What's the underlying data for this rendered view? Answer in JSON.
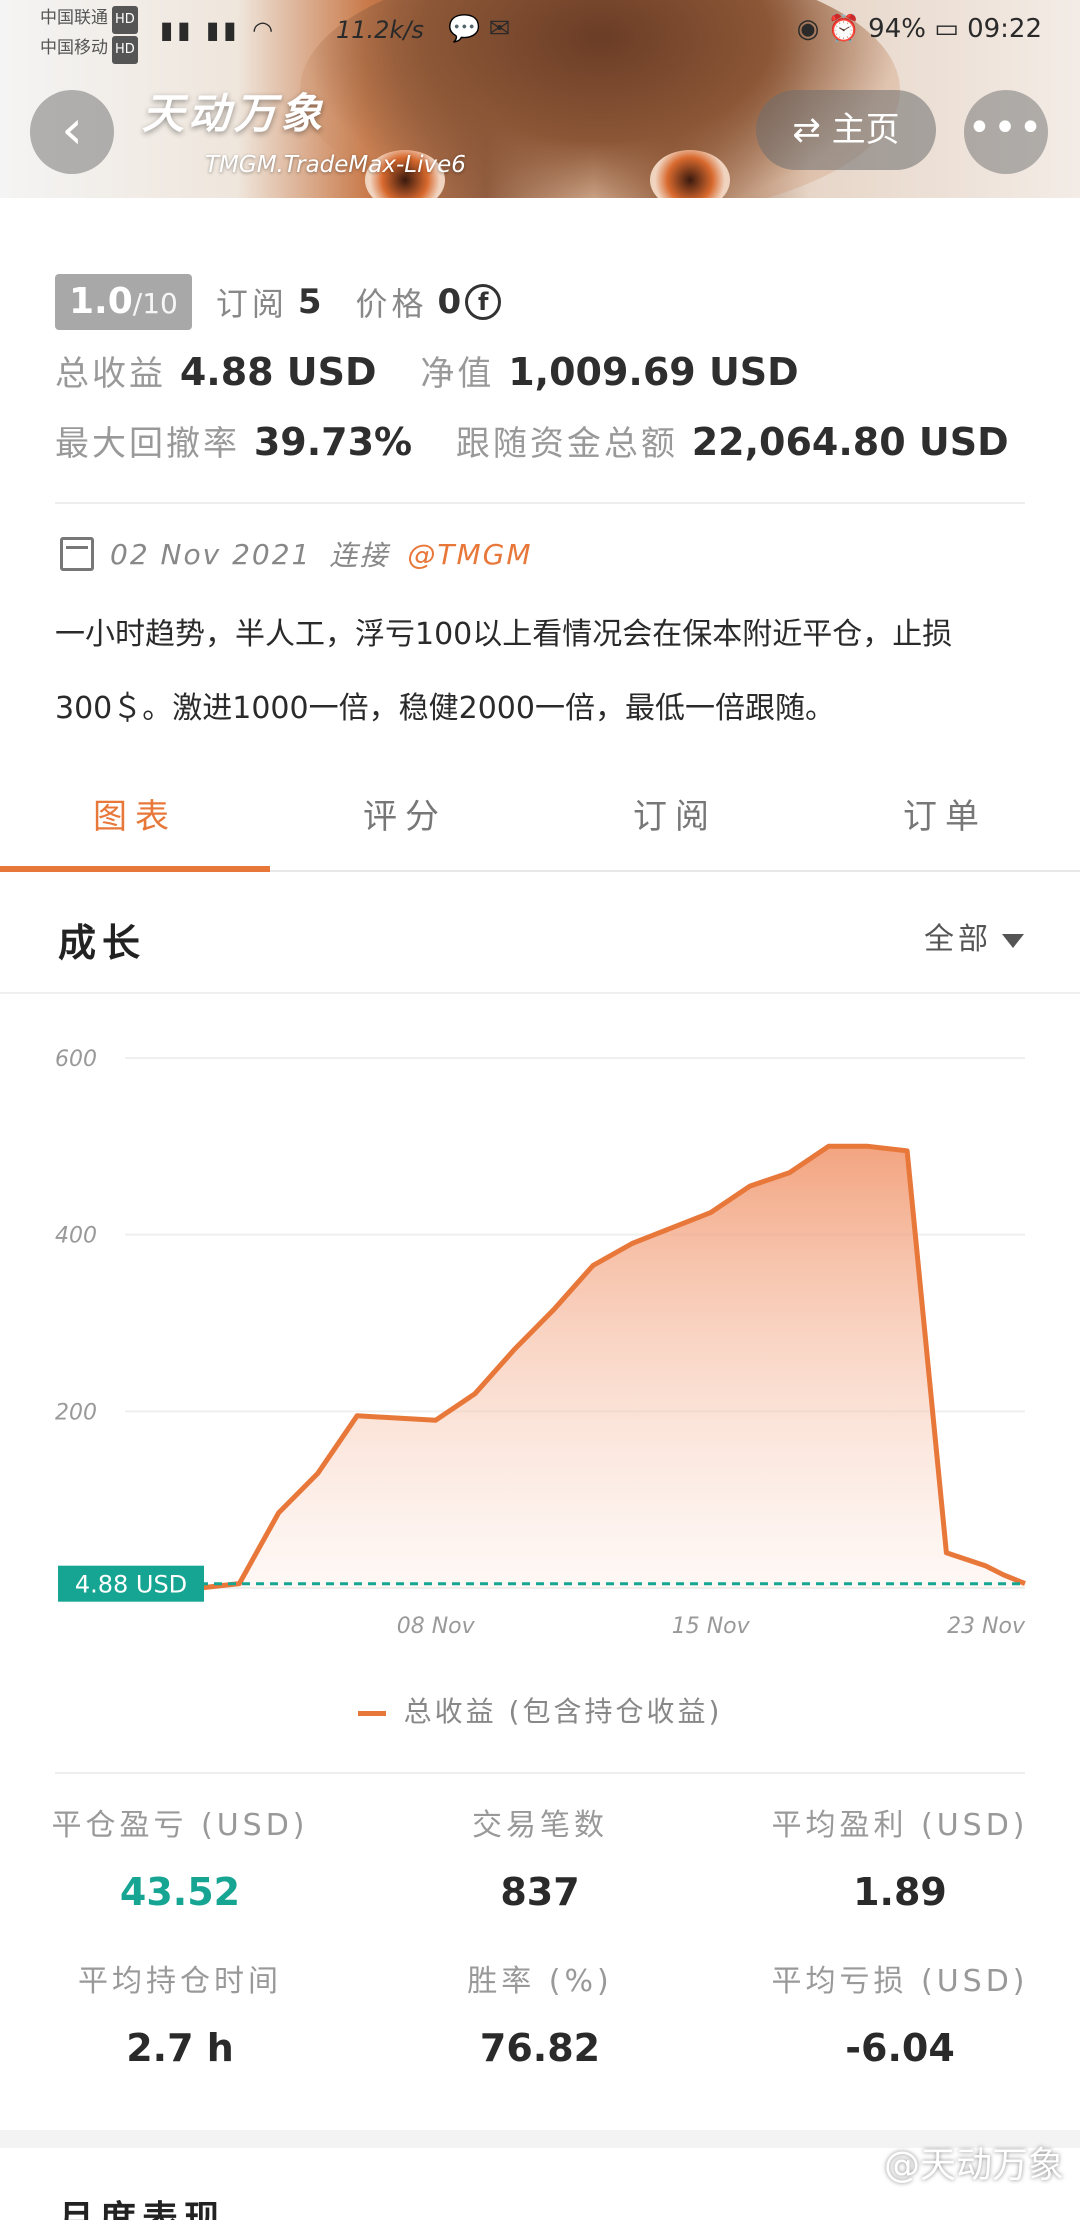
{
  "status_bar": {
    "carrier1": "中国联通",
    "carrier2": "中国移动",
    "hd": "HD",
    "speed": "11.2k/s",
    "battery": "94%",
    "time": "09:22"
  },
  "header": {
    "title": "天动万象",
    "subtitle": "TMGM.TradeMax-Live6",
    "home_label": "主页"
  },
  "profile": {
    "rating_value": "1.0",
    "rating_denominator": "/10",
    "subscribe_label": "订阅",
    "subscribe_count": "5",
    "price_label": "价格",
    "price_value": "0",
    "total_profit_label": "总收益",
    "total_profit_value": "4.88 USD",
    "equity_label": "净值",
    "equity_value": "1,009.69 USD",
    "max_drawdown_label": "最大回撤率",
    "max_drawdown_value": "39.73%",
    "follow_funds_label": "跟随资金总额",
    "follow_funds_value": "22,064.80 USD",
    "date": "02 Nov 2021",
    "connect_label": "连接",
    "connect_broker": "@TMGM",
    "description": "一小时趋势，半人工，浮亏100以上看情况会在保本附近平仓，止损300＄。激进1000一倍，稳健2000一倍，最低一倍跟随。"
  },
  "tabs": [
    {
      "label": "图表",
      "active": true
    },
    {
      "label": "评分",
      "active": false
    },
    {
      "label": "订阅",
      "active": false
    },
    {
      "label": "订单",
      "active": false
    }
  ],
  "growth": {
    "title": "成长",
    "range": "全部",
    "legend": "总收益 (包含持仓收益)",
    "current_badge": "4.88 USD"
  },
  "chart_data": {
    "type": "area",
    "series": [
      {
        "name": "总收益 (包含持仓收益)",
        "x": [
          "02 Nov",
          "03 Nov",
          "04 Nov",
          "05 Nov",
          "06 Nov",
          "08 Nov",
          "09 Nov",
          "10 Nov",
          "11 Nov",
          "12 Nov",
          "13 Nov",
          "15 Nov",
          "16 Nov",
          "17 Nov",
          "18 Nov",
          "19 Nov",
          "20 Nov",
          "21 Nov",
          "22 Nov",
          "22 Nov",
          "23 Nov"
        ],
        "values": [
          0,
          5,
          85,
          130,
          195,
          190,
          220,
          270,
          315,
          365,
          390,
          425,
          455,
          470,
          500,
          500,
          495,
          40,
          25,
          15,
          5
        ]
      }
    ],
    "x_ticks": [
      "08 Nov",
      "15 Nov",
      "23 Nov"
    ],
    "y_ticks": [
      0,
      200,
      400,
      600
    ],
    "ylim": [
      0,
      600
    ],
    "baseline_value": 4.88,
    "grid": true,
    "color": "#e8773a",
    "baseline_color": "#16a592"
  },
  "stats": [
    {
      "label": "平仓盈亏 (USD)",
      "value": "43.52",
      "color": "green"
    },
    {
      "label": "交易笔数",
      "value": "837",
      "color": "dark"
    },
    {
      "label": "平均盈利 (USD)",
      "value": "1.89",
      "color": "dark"
    },
    {
      "label": "平均持仓时间",
      "value": "2.7 h",
      "color": "dark"
    },
    {
      "label": "胜率 (%)",
      "value": "76.82",
      "color": "dark"
    },
    {
      "label": "平均亏损 (USD)",
      "value": "-6.04",
      "color": "dark"
    }
  ],
  "monthly": {
    "title": "月度表现"
  },
  "watermark": "@天动万象"
}
